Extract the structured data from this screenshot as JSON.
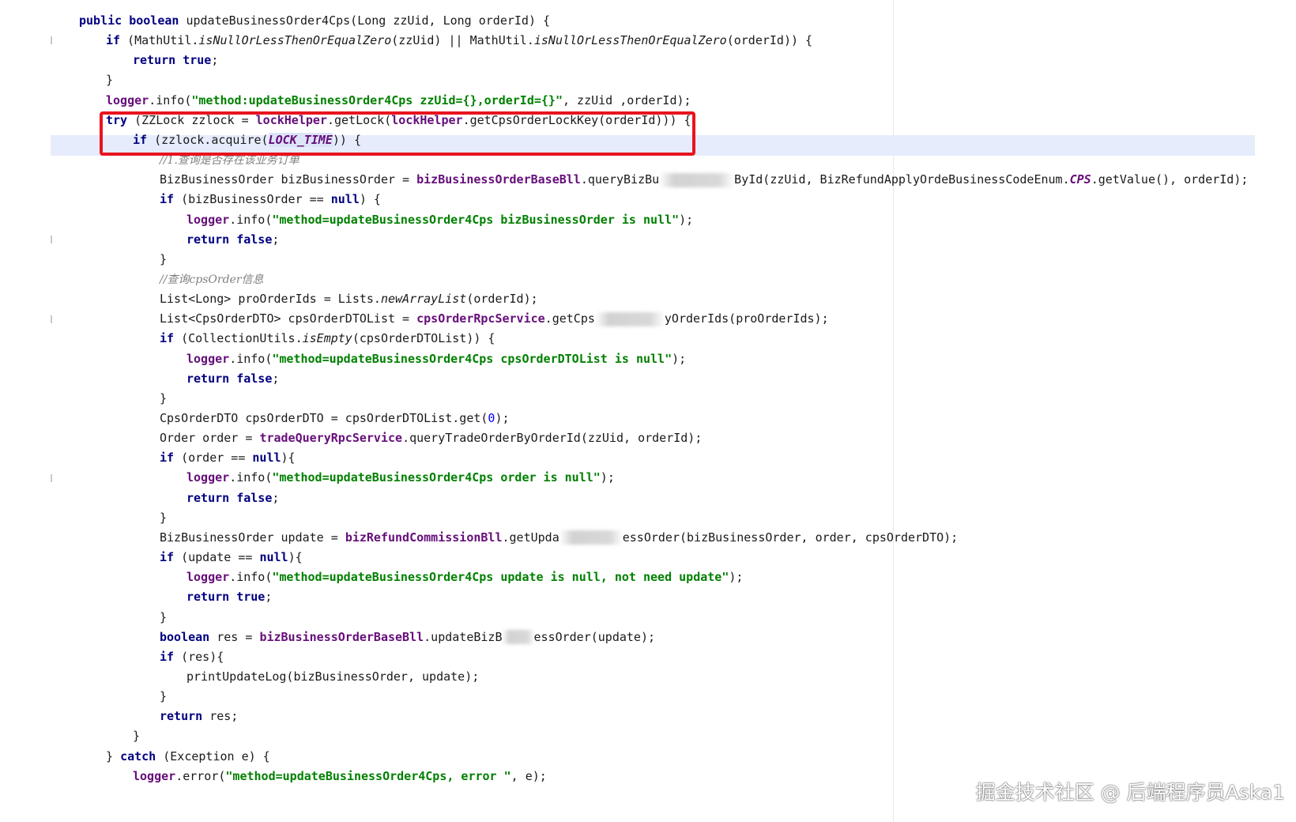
{
  "editor": {
    "lines": [
      {
        "indent": 1,
        "parts": [
          {
            "t": "public ",
            "c": "kw"
          },
          {
            "t": "boolean ",
            "c": "kw"
          },
          {
            "t": "updateBusinessOrder4Cps(Long zzUid, Long orderId) {"
          }
        ]
      },
      {
        "indent": 2,
        "parts": [
          {
            "t": "if ",
            "c": "kw"
          },
          {
            "t": "(MathUtil."
          },
          {
            "t": "isNullOrLessThenOrEqualZero",
            "c": "ital"
          },
          {
            "t": "(zzUid) || MathUtil."
          },
          {
            "t": "isNullOrLessThenOrEqualZero",
            "c": "ital"
          },
          {
            "t": "(orderId)) {"
          }
        ]
      },
      {
        "indent": 3,
        "parts": [
          {
            "t": "return ",
            "c": "kw"
          },
          {
            "t": "true",
            "c": "kw"
          },
          {
            "t": ";"
          }
        ]
      },
      {
        "indent": 2,
        "parts": [
          {
            "t": "}"
          }
        ]
      },
      {
        "indent": 2,
        "parts": [
          {
            "t": "logger",
            "c": "fld"
          },
          {
            "t": ".info("
          },
          {
            "t": "\"method:updateBusinessOrder4Cps zzUid={},orderId={}\"",
            "c": "str"
          },
          {
            "t": ", zzUid ,orderId);"
          }
        ]
      },
      {
        "indent": 2,
        "parts": [
          {
            "t": "try ",
            "c": "kw"
          },
          {
            "t": "(ZZLock zzlock = "
          },
          {
            "t": "lockHelper",
            "c": "fld"
          },
          {
            "t": ".getLock("
          },
          {
            "t": "lockHelper",
            "c": "fld"
          },
          {
            "t": ".getCpsOrderLockKey(orderId))) {"
          }
        ]
      },
      {
        "indent": 3,
        "parts": [
          {
            "t": "if ",
            "c": "kw"
          },
          {
            "t": "(zzlock.acquire("
          },
          {
            "t": "LOCK_TIME",
            "c": "const sel"
          },
          {
            "t": ")) {"
          }
        ]
      },
      {
        "indent": 4,
        "parts": [
          {
            "t": "//1.查询是否存在该业务订单",
            "c": "cmt"
          }
        ]
      },
      {
        "indent": 4,
        "parts": [
          {
            "t": "BizBusinessOrder bizBusinessOrder = "
          },
          {
            "t": "bizBusinessOrderBaseBll",
            "c": "fld"
          },
          {
            "t": ".queryBizBu"
          },
          {
            "blur": 95
          },
          {
            "t": "ById(zzUid, BizRefundApplyOrdeBusinessCodeEnum."
          },
          {
            "t": "CPS",
            "c": "const"
          },
          {
            "t": ".getValue(), orderId);"
          }
        ]
      },
      {
        "indent": 4,
        "parts": [
          {
            "t": "if ",
            "c": "kw"
          },
          {
            "t": "(bizBusinessOrder == "
          },
          {
            "t": "null",
            "c": "kw"
          },
          {
            "t": ") {"
          }
        ]
      },
      {
        "indent": 5,
        "parts": [
          {
            "t": "logger",
            "c": "fld"
          },
          {
            "t": ".info("
          },
          {
            "t": "\"method=updateBusinessOrder4Cps bizBusinessOrder is null\"",
            "c": "str"
          },
          {
            "t": ");"
          }
        ]
      },
      {
        "indent": 5,
        "parts": [
          {
            "t": "return ",
            "c": "kw"
          },
          {
            "t": "false",
            "c": "kw"
          },
          {
            "t": ";"
          }
        ]
      },
      {
        "indent": 4,
        "parts": [
          {
            "t": "}"
          }
        ]
      },
      {
        "indent": 4,
        "parts": [
          {
            "t": "//查询cpsOrder信息",
            "c": "cmt"
          }
        ]
      },
      {
        "indent": 4,
        "parts": [
          {
            "t": "List<Long> proOrderIds = Lists."
          },
          {
            "t": "newArrayList",
            "c": "ital"
          },
          {
            "t": "(orderId);"
          }
        ]
      },
      {
        "indent": 4,
        "parts": [
          {
            "t": "List<CpsOrderDTO> cpsOrderDTOList = "
          },
          {
            "t": "cpsOrderRpcService",
            "c": "fld"
          },
          {
            "t": ".getCps"
          },
          {
            "blur": 88
          },
          {
            "t": "yOrderIds(proOrderIds);"
          }
        ]
      },
      {
        "indent": 4,
        "parts": [
          {
            "t": "if ",
            "c": "kw"
          },
          {
            "t": "(CollectionUtils."
          },
          {
            "t": "isEmpty",
            "c": "ital"
          },
          {
            "t": "(cpsOrderDTOList)) {"
          }
        ]
      },
      {
        "indent": 5,
        "parts": [
          {
            "t": "logger",
            "c": "fld"
          },
          {
            "t": ".info("
          },
          {
            "t": "\"method=updateBusinessOrder4Cps cpsOrderDTOList is null\"",
            "c": "str"
          },
          {
            "t": ");"
          }
        ]
      },
      {
        "indent": 5,
        "parts": [
          {
            "t": "return ",
            "c": "kw"
          },
          {
            "t": "false",
            "c": "kw"
          },
          {
            "t": ";"
          }
        ]
      },
      {
        "indent": 4,
        "parts": [
          {
            "t": "}"
          }
        ]
      },
      {
        "indent": 4,
        "parts": [
          {
            "t": "CpsOrderDTO cpsOrderDTO = cpsOrderDTOList.get("
          },
          {
            "t": "0",
            "c": "num"
          },
          {
            "t": ");"
          }
        ]
      },
      {
        "indent": 4,
        "parts": [
          {
            "t": "Order order = "
          },
          {
            "t": "tradeQueryRpcService",
            "c": "fld"
          },
          {
            "t": ".queryTradeOrderByOrderId(zzUid, orderId);"
          }
        ]
      },
      {
        "indent": 4,
        "parts": [
          {
            "t": "if ",
            "c": "kw"
          },
          {
            "t": "(order == "
          },
          {
            "t": "null",
            "c": "kw"
          },
          {
            "t": "){"
          }
        ]
      },
      {
        "indent": 5,
        "parts": [
          {
            "t": "logger",
            "c": "fld"
          },
          {
            "t": ".info("
          },
          {
            "t": "\"method=updateBusinessOrder4Cps order is null\"",
            "c": "str"
          },
          {
            "t": ");"
          }
        ]
      },
      {
        "indent": 5,
        "parts": [
          {
            "t": "return ",
            "c": "kw"
          },
          {
            "t": "false",
            "c": "kw"
          },
          {
            "t": ";"
          }
        ]
      },
      {
        "indent": 4,
        "parts": [
          {
            "t": "}"
          }
        ]
      },
      {
        "indent": 4,
        "parts": [
          {
            "t": "BizBusinessOrder update = "
          },
          {
            "t": "bizRefundCommissionBll",
            "c": "fld"
          },
          {
            "t": ".getUpda"
          },
          {
            "blur": 80
          },
          {
            "t": "essOrder(bizBusinessOrder, order, cpsOrderDTO);"
          }
        ]
      },
      {
        "indent": 4,
        "parts": [
          {
            "t": "if ",
            "c": "kw"
          },
          {
            "t": "(update == "
          },
          {
            "t": "null",
            "c": "kw"
          },
          {
            "t": "){"
          }
        ]
      },
      {
        "indent": 5,
        "parts": [
          {
            "t": "logger",
            "c": "fld"
          },
          {
            "t": ".info("
          },
          {
            "t": "\"method=updateBusinessOrder4Cps update is null, not need update\"",
            "c": "str"
          },
          {
            "t": ");"
          }
        ]
      },
      {
        "indent": 5,
        "parts": [
          {
            "t": "return ",
            "c": "kw"
          },
          {
            "t": "true",
            "c": "kw"
          },
          {
            "t": ";"
          }
        ]
      },
      {
        "indent": 4,
        "parts": [
          {
            "t": "}"
          }
        ]
      },
      {
        "indent": 4,
        "parts": [
          {
            "t": "boolean ",
            "c": "kw"
          },
          {
            "t": "res = "
          },
          {
            "t": "bizBusinessOrderBaseBll",
            "c": "fld"
          },
          {
            "t": ".updateBizB"
          },
          {
            "blur": 40
          },
          {
            "t": "essOrder(update);"
          }
        ]
      },
      {
        "indent": 4,
        "parts": [
          {
            "t": "if ",
            "c": "kw"
          },
          {
            "t": "(res){"
          }
        ]
      },
      {
        "indent": 5,
        "parts": [
          {
            "t": "printUpdateLog(bizBusinessOrder, update);"
          }
        ]
      },
      {
        "indent": 4,
        "parts": [
          {
            "t": "}"
          }
        ]
      },
      {
        "indent": 4,
        "parts": [
          {
            "t": "return ",
            "c": "kw"
          },
          {
            "t": "res;"
          }
        ]
      },
      {
        "indent": 3,
        "parts": [
          {
            "t": "}"
          }
        ]
      },
      {
        "indent": 2,
        "parts": [
          {
            "t": "} "
          },
          {
            "t": "catch ",
            "c": "kw"
          },
          {
            "t": "(Exception e) {"
          }
        ]
      },
      {
        "indent": 3,
        "parts": [
          {
            "t": "logger",
            "c": "fld"
          },
          {
            "t": ".error("
          },
          {
            "t": "\"method=updateBusinessOrder4Cps, error \"",
            "c": "str"
          },
          {
            "t": ", e);"
          }
        ]
      }
    ]
  },
  "watermark": "掘金技术社区 @ 后端程序员Aska1",
  "colors": {
    "keyword": "#000080",
    "field": "#660e7a",
    "string": "#008000",
    "highlight_box": "#e8141e",
    "current_line": "#e6ecfb"
  }
}
